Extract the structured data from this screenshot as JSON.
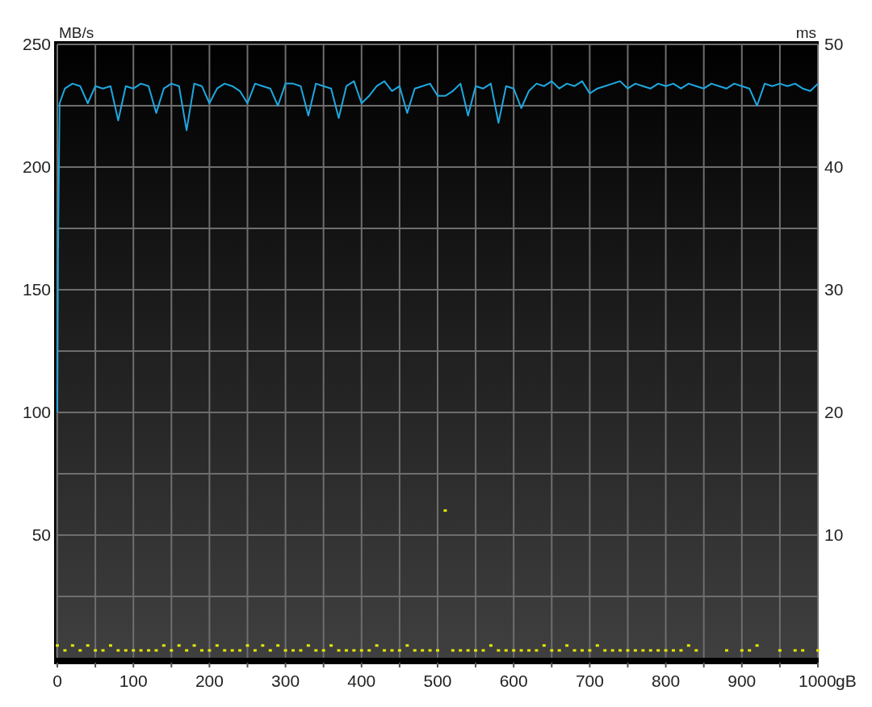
{
  "chart_data": {
    "type": "line",
    "grid": true,
    "ylabel": "MB/s",
    "y2label": "ms",
    "xlabel": "gB",
    "xlim": [
      0,
      1000
    ],
    "ylim": [
      0,
      250
    ],
    "y2lim": [
      0,
      50
    ],
    "xticks": [
      0,
      100,
      200,
      300,
      400,
      500,
      600,
      700,
      800,
      900,
      1000
    ],
    "yticks": [
      50,
      100,
      150,
      200,
      250
    ],
    "y2ticks": [
      10,
      20,
      30,
      40,
      50
    ],
    "x": [
      0,
      1,
      3,
      10,
      20,
      30,
      40,
      50,
      60,
      70,
      80,
      90,
      100,
      110,
      120,
      130,
      140,
      150,
      160,
      170,
      180,
      190,
      200,
      210,
      220,
      230,
      240,
      250,
      260,
      270,
      280,
      290,
      300,
      310,
      320,
      330,
      340,
      350,
      360,
      370,
      380,
      390,
      400,
      410,
      420,
      430,
      440,
      450,
      460,
      470,
      480,
      490,
      500,
      510,
      520,
      530,
      540,
      550,
      560,
      570,
      580,
      590,
      600,
      610,
      620,
      630,
      640,
      650,
      660,
      670,
      680,
      690,
      700,
      710,
      720,
      730,
      740,
      750,
      760,
      770,
      780,
      790,
      800,
      810,
      820,
      830,
      840,
      850,
      860,
      870,
      880,
      890,
      900,
      910,
      920,
      930,
      940,
      950,
      960,
      970,
      980,
      990,
      1000
    ],
    "series": [
      {
        "color": "#1ea8e0",
        "values": [
          100,
          165,
          226,
          232,
          234,
          233,
          226,
          233,
          232,
          233,
          219,
          233,
          232,
          234,
          233,
          222,
          232,
          234,
          233,
          215,
          234,
          233,
          226,
          232,
          234,
          233,
          231,
          226,
          234,
          233,
          232,
          225,
          234,
          234,
          233,
          221,
          234,
          233,
          232,
          220,
          233,
          235,
          226,
          229,
          233,
          235,
          231,
          233,
          222,
          232,
          233,
          234,
          229,
          229,
          231,
          234,
          221,
          233,
          232,
          234,
          218,
          233,
          232,
          224,
          231,
          234,
          233,
          235,
          232,
          234,
          233,
          235,
          230,
          232,
          233,
          234,
          235,
          232,
          234,
          233,
          232,
          234,
          233,
          234,
          232,
          234,
          233,
          232,
          234,
          233,
          232,
          234,
          233,
          232,
          225,
          234,
          233,
          234,
          233,
          234,
          232,
          231,
          234
        ]
      },
      {
        "type": "scatter",
        "axis": "y2",
        "color": "#e8e800",
        "values": [
          1.0,
          null,
          null,
          0.6,
          1.0,
          0.6,
          1.0,
          0.6,
          0.6,
          1.0,
          0.6,
          0.6,
          0.6,
          0.6,
          0.6,
          0.6,
          1.0,
          0.6,
          1.0,
          0.6,
          1.0,
          0.6,
          0.6,
          1.0,
          0.6,
          0.6,
          0.6,
          1.0,
          0.6,
          1.0,
          0.6,
          1.0,
          0.6,
          0.6,
          0.6,
          1.0,
          0.6,
          0.6,
          1.0,
          0.6,
          0.6,
          0.6,
          0.6,
          0.6,
          1.0,
          0.6,
          0.6,
          0.6,
          1.0,
          0.6,
          0.6,
          0.6,
          0.6,
          12,
          0.6,
          0.6,
          0.6,
          0.6,
          0.6,
          1.0,
          0.6,
          0.6,
          0.6,
          0.6,
          0.6,
          0.6,
          1.0,
          0.6,
          0.6,
          1.0,
          0.6,
          0.6,
          0.6,
          1.0,
          0.6,
          0.6,
          0.6,
          0.6,
          0.6,
          0.6,
          0.6,
          0.6,
          0.6,
          0.6,
          0.6,
          1.0,
          0.6,
          null,
          null,
          null,
          0.6,
          null,
          0.6,
          0.6,
          1.0,
          null,
          null,
          0.6,
          null,
          0.6,
          0.6,
          null,
          0.6
        ]
      }
    ]
  }
}
